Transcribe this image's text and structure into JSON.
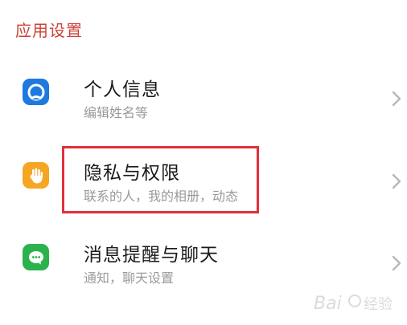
{
  "section_title": "应用设置",
  "items": [
    {
      "title": "个人信息",
      "subtitle": "编辑姓名等",
      "icon": "person-icon",
      "icon_color": "#1f7ae0"
    },
    {
      "title": "隐私与权限",
      "subtitle": "联系的人，我的相册，动态",
      "icon": "hand-icon",
      "icon_color": "#f5a623"
    },
    {
      "title": "消息提醒与聊天",
      "subtitle": "通知，聊天设置",
      "icon": "chat-icon",
      "icon_color": "#2bb24c"
    },
    {
      "title": "",
      "subtitle": "",
      "icon": "",
      "icon_color": ""
    }
  ],
  "highlight_color": "#e0303a",
  "watermark": "Baidu 经验"
}
